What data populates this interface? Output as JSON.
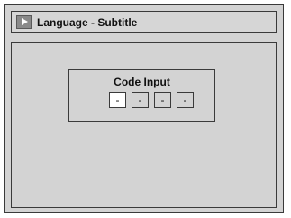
{
  "header": {
    "title": "Language - Subtitle",
    "icon": "play-icon"
  },
  "code_input": {
    "title": "Code Input",
    "digits": [
      "-",
      "-",
      "-",
      "-"
    ],
    "active_index": 0
  },
  "colors": {
    "background": "#d3d3d3",
    "active_digit": "#ffffff",
    "border": "#3a3a3a"
  }
}
